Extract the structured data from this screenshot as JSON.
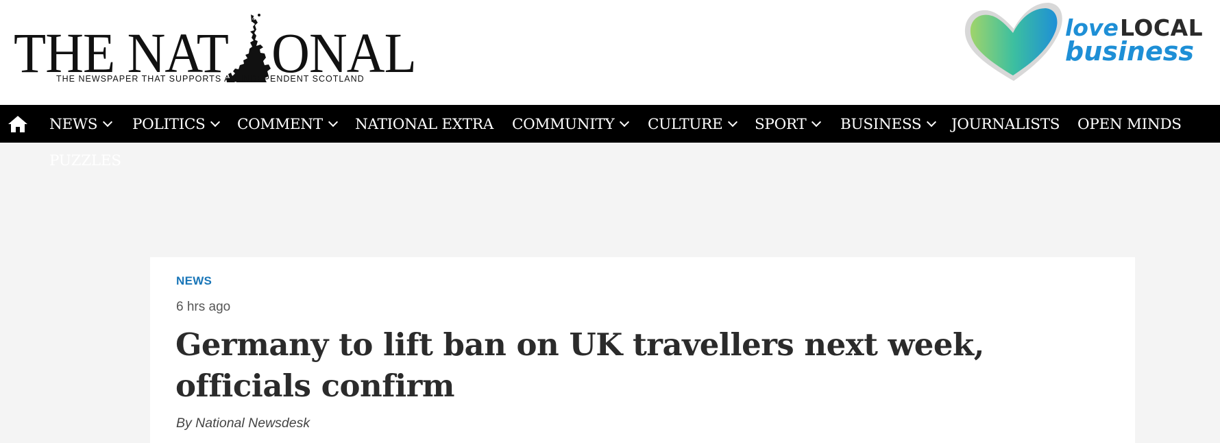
{
  "header": {
    "logo_left": "THE NAT",
    "logo_right": "ONAL",
    "tagline": "THE NEWSPAPER THAT SUPPORTS AN INDEPENDENT SCOTLAND",
    "promo": {
      "love": "love",
      "local": "LOCAL",
      "business": "business"
    }
  },
  "nav": {
    "home_icon": "home-icon",
    "items": [
      {
        "label": "NEWS",
        "dropdown": true
      },
      {
        "label": "POLITICS",
        "dropdown": true
      },
      {
        "label": "COMMENT",
        "dropdown": true
      },
      {
        "label": "NATIONAL EXTRA",
        "dropdown": false
      },
      {
        "label": "COMMUNITY",
        "dropdown": true
      },
      {
        "label": "CULTURE",
        "dropdown": true
      },
      {
        "label": "SPORT",
        "dropdown": true
      },
      {
        "label": "BUSINESS",
        "dropdown": true
      },
      {
        "label": "JOURNALISTS",
        "dropdown": false
      },
      {
        "label": "OPEN MINDS",
        "dropdown": false
      },
      {
        "label": "PUZZLES",
        "dropdown": false
      }
    ]
  },
  "article": {
    "section": "NEWS",
    "time": "6 hrs ago",
    "headline": "Germany to lift ban on UK travellers next week, officials confirm",
    "byline": "By National Newsdesk"
  },
  "colors": {
    "nav_bg": "#000000",
    "section_blue": "#1976b8",
    "promo_blue": "#1e8fd6",
    "page_bg": "#f4f4f4"
  }
}
